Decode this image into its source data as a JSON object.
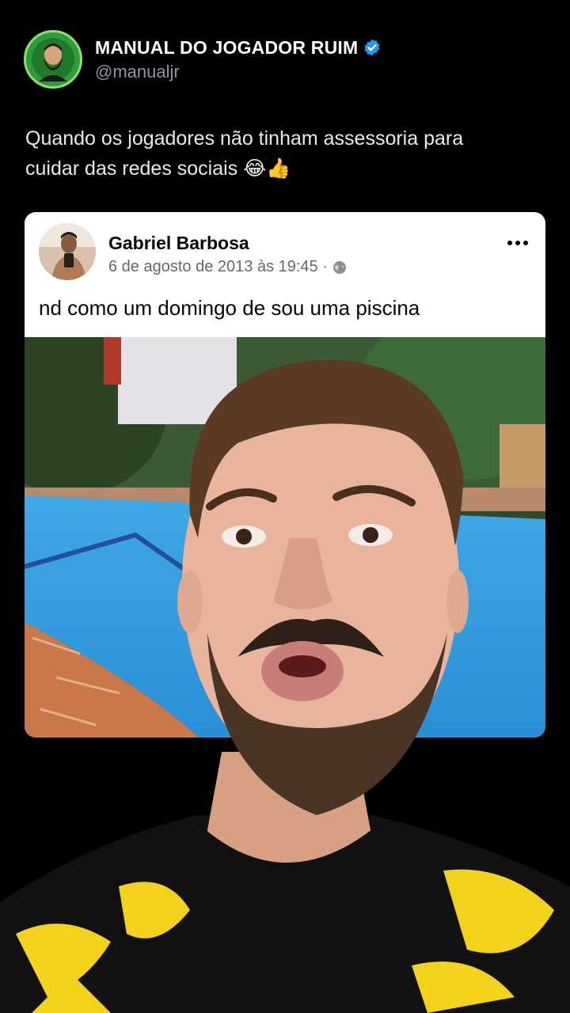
{
  "tweet": {
    "display_name": "MANUAL DO JOGADOR RUIM",
    "handle": "@manualjr",
    "text_line1": "Quando os jogadores não tinham assessoria para",
    "text_line2": "cuidar das redes sociais",
    "emojis": "😂👍",
    "avatar_icon": "bearded-man-avatar-icon",
    "verified_icon": "verified-badge-icon",
    "colors": {
      "background": "#000000",
      "handle": "#8b98a5",
      "verified": "#1d9bf0",
      "avatar_ring": "#2e9b3e"
    }
  },
  "facebook_post": {
    "author": "Gabriel Barbosa",
    "date": "6 de agosto de 2013 às 19:45 ·",
    "privacy_icon": "globe-icon",
    "more_icon": "more-options-icon",
    "text": "nd como um domingo de sou uma piscina",
    "photo": "swimming-pool-photo"
  },
  "video_overlay": {
    "subject": "man-face-webcam-overlay",
    "shirt_colors": [
      "#111111",
      "#f2d21b"
    ]
  }
}
